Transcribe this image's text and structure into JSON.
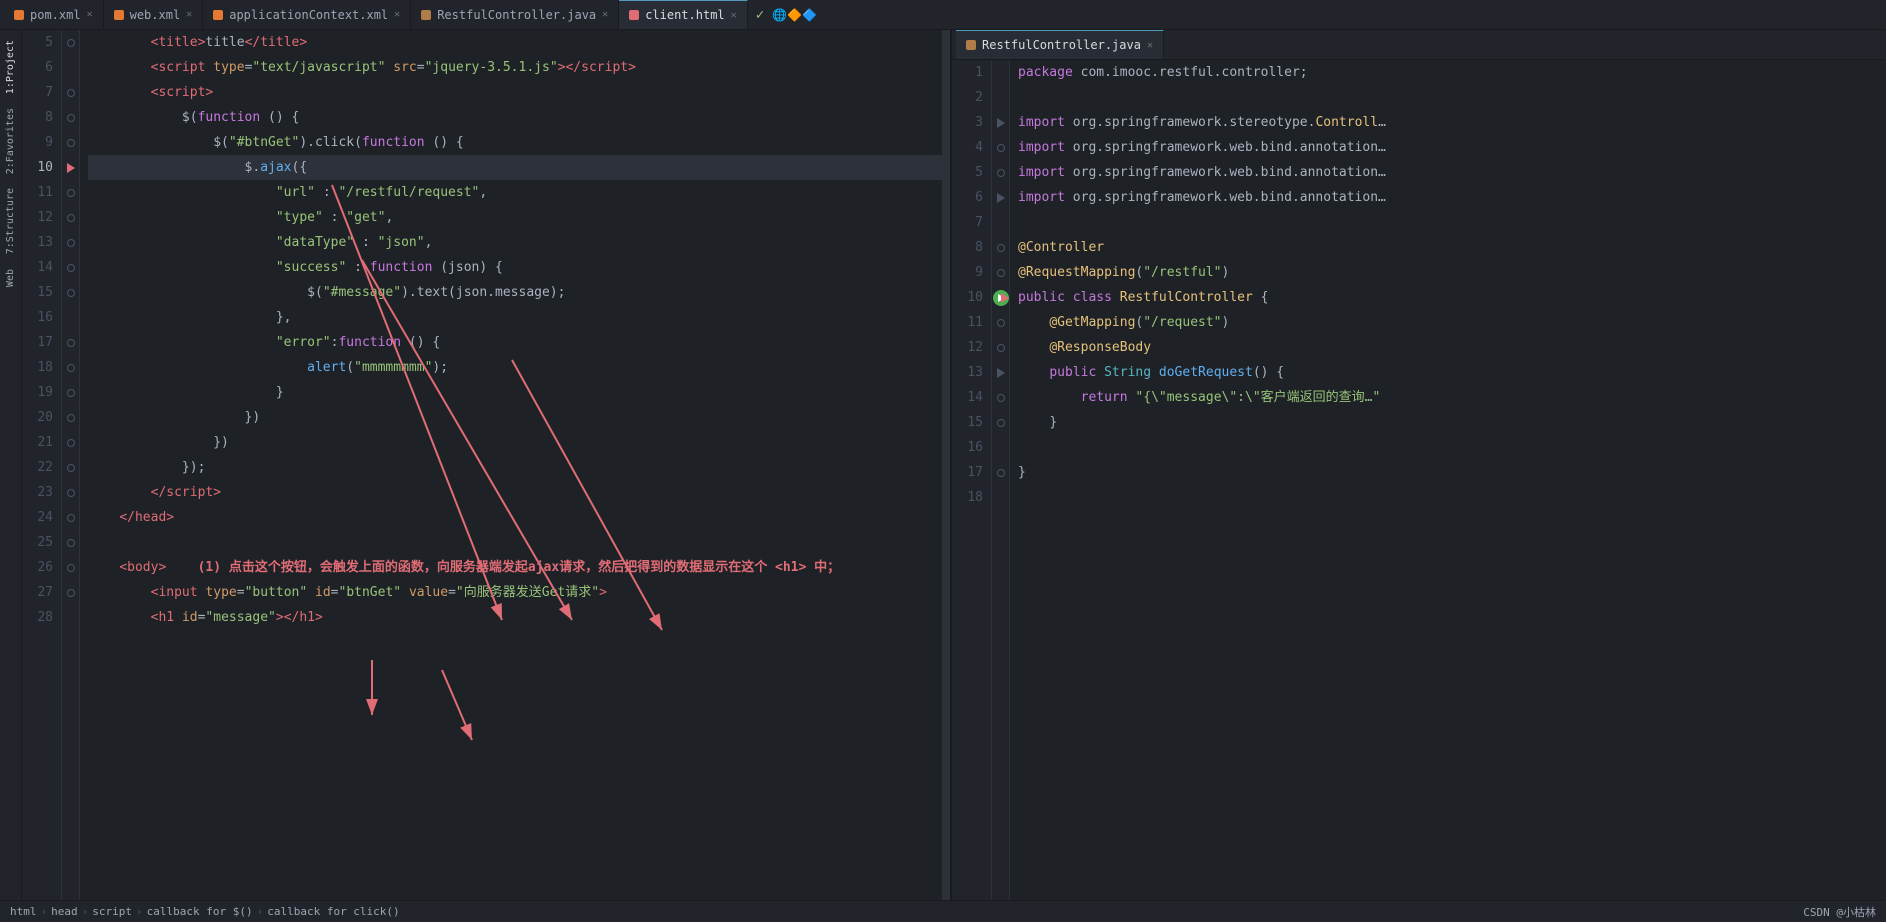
{
  "tabs_left": [
    {
      "label": "pom.xml",
      "icon": "xml",
      "active": false,
      "id": "pom"
    },
    {
      "label": "web.xml",
      "icon": "xml",
      "active": false,
      "id": "web"
    },
    {
      "label": "applicationContext.xml",
      "icon": "xml",
      "active": false,
      "id": "appctx"
    },
    {
      "label": "RestfulController.java",
      "icon": "java",
      "active": false,
      "id": "restful1"
    },
    {
      "label": "client.html",
      "icon": "html",
      "active": true,
      "id": "client"
    }
  ],
  "tab_right": {
    "label": "RestfulController.java",
    "icon": "java",
    "active": true
  },
  "left_code": [
    {
      "ln": 5,
      "code": "        <title>title</title>",
      "type": "plain"
    },
    {
      "ln": 6,
      "code": "        <script type=\"text/javascript\" src=\"jquery-3.5.1.js\"><\\/script>",
      "type": "plain"
    },
    {
      "ln": 7,
      "code": "        <script>",
      "type": "plain"
    },
    {
      "ln": 8,
      "code": "            $(function () {",
      "type": "plain"
    },
    {
      "ln": 9,
      "code": "                $(\"#btnGet\").click(function () {",
      "type": "plain"
    },
    {
      "ln": 10,
      "code": "                    $.ajax({",
      "type": "plain",
      "current": true
    },
    {
      "ln": 11,
      "code": "                        \"url\" : \"/restful/request\",",
      "type": "plain"
    },
    {
      "ln": 12,
      "code": "                        \"type\" : \"get\",",
      "type": "plain"
    },
    {
      "ln": 13,
      "code": "                        \"dataType\" : \"json\",",
      "type": "plain"
    },
    {
      "ln": 14,
      "code": "                        \"success\" : function (json) {",
      "type": "plain"
    },
    {
      "ln": 15,
      "code": "                            $(\"#message\").text(json.message);",
      "type": "plain"
    },
    {
      "ln": 16,
      "code": "                        },",
      "type": "plain"
    },
    {
      "ln": 17,
      "code": "                        \"error\":function () {",
      "type": "plain"
    },
    {
      "ln": 18,
      "code": "                            alert(\"mmmmmmmm\");",
      "type": "plain"
    },
    {
      "ln": 19,
      "code": "                        }",
      "type": "plain"
    },
    {
      "ln": 20,
      "code": "                    })",
      "type": "plain"
    },
    {
      "ln": 21,
      "code": "                })",
      "type": "plain"
    },
    {
      "ln": 22,
      "code": "            });",
      "type": "plain"
    },
    {
      "ln": 23,
      "code": "        <\\/script>",
      "type": "plain"
    },
    {
      "ln": 24,
      "code": "    <\\/head>",
      "type": "plain"
    },
    {
      "ln": 25,
      "code": "    <body>",
      "type": "plain"
    },
    {
      "ln": 26,
      "code": "        <input type=\"button\" id=\"btnGet\" value=\"向服务器发送Get请求\">",
      "type": "plain"
    },
    {
      "ln": 27,
      "code": "        <h1 id=\"message\"></h1>",
      "type": "plain"
    },
    {
      "ln": 28,
      "code": "",
      "type": "plain"
    }
  ],
  "right_code": [
    {
      "ln": 1,
      "code": "package com.imooc.restful.controller;",
      "type": "plain"
    },
    {
      "ln": 2,
      "code": "",
      "type": "plain"
    },
    {
      "ln": 3,
      "code": "import org.springframework.stereotype.Controll",
      "type": "plain"
    },
    {
      "ln": 4,
      "code": "import org.springframework.web.bind.annotation",
      "type": "plain"
    },
    {
      "ln": 5,
      "code": "import org.springframework.web.bind.annotation",
      "type": "plain"
    },
    {
      "ln": 6,
      "code": "import org.springframework.web.bind.annotation",
      "type": "plain"
    },
    {
      "ln": 7,
      "code": "",
      "type": "plain"
    },
    {
      "ln": 8,
      "code": "@Controller",
      "type": "plain"
    },
    {
      "ln": 9,
      "code": "@RequestMapping(\"/restful\")",
      "type": "plain"
    },
    {
      "ln": 10,
      "code": "public class RestfulController {",
      "type": "plain"
    },
    {
      "ln": 11,
      "code": "    @GetMapping(\"/request\")",
      "type": "plain"
    },
    {
      "ln": 12,
      "code": "    @ResponseBody",
      "type": "plain"
    },
    {
      "ln": 13,
      "code": "    public String doGetRequest() {",
      "type": "plain"
    },
    {
      "ln": 14,
      "code": "        return \"{\\\"message\\\":\\\"客户端返回的查询",
      "type": "plain"
    },
    {
      "ln": 15,
      "code": "    }",
      "type": "plain"
    },
    {
      "ln": 16,
      "code": "",
      "type": "plain"
    },
    {
      "ln": 17,
      "code": "}",
      "type": "plain"
    },
    {
      "ln": 18,
      "code": "",
      "type": "plain"
    }
  ],
  "status_bar": {
    "breadcrumb": [
      "html",
      "head",
      "script",
      "callback for $()",
      "callback for click()"
    ],
    "right_text": "CSDN @小枯林"
  },
  "annotation": {
    "text": "(1) 点击这个按钮，会触发上面的函数，向服务器端发起ajax请求，然后把得到的数据显示在这个 <h1> 中；"
  },
  "sidebar_items": [
    "1:Project",
    "2:Favorites",
    "7:Structure",
    "Web"
  ]
}
